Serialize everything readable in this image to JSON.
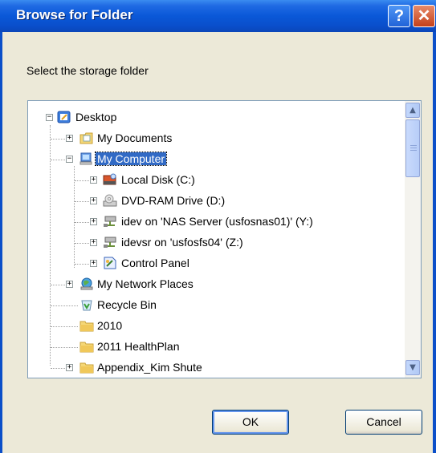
{
  "window": {
    "title": "Browse for Folder",
    "help_glyph": "?",
    "close_glyph": "✕"
  },
  "dialog": {
    "prompt": "Select the storage folder"
  },
  "tree": {
    "items": [
      {
        "label": "Desktop",
        "icon": "desktop-icon",
        "expander": "−"
      },
      {
        "label": "My Documents",
        "icon": "folder-documents-icon",
        "expander": "+"
      },
      {
        "label": "My Computer",
        "icon": "computer-icon",
        "expander": "−",
        "selected": true
      },
      {
        "label": "Local Disk (C:)",
        "icon": "hard-disk-icon",
        "expander": "+"
      },
      {
        "label": "DVD-RAM Drive (D:)",
        "icon": "dvd-drive-icon",
        "expander": "+"
      },
      {
        "label": "idev on 'NAS Server (usfosnas01)' (Y:)",
        "icon": "network-drive-icon",
        "expander": "+"
      },
      {
        "label": "idevsr on 'usfosfs04' (Z:)",
        "icon": "network-drive-icon",
        "expander": "+"
      },
      {
        "label": "Control Panel",
        "icon": "control-panel-icon",
        "expander": "+"
      },
      {
        "label": "My Network Places",
        "icon": "network-places-icon",
        "expander": "+"
      },
      {
        "label": "Recycle Bin",
        "icon": "recycle-bin-icon",
        "expander": ""
      },
      {
        "label": "2010",
        "icon": "folder-icon",
        "expander": ""
      },
      {
        "label": "2011 HealthPlan",
        "icon": "folder-icon",
        "expander": ""
      },
      {
        "label": "Appendix_Kim Shute",
        "icon": "folder-icon",
        "expander": "+"
      }
    ]
  },
  "scrollbar": {
    "up_glyph": "▲",
    "down_glyph": "▼"
  },
  "buttons": {
    "ok": "OK",
    "cancel": "Cancel"
  },
  "colors": {
    "title_bar": "#0a58d8",
    "selection": "#316ac5",
    "dialog_bg": "#ece9d8"
  }
}
